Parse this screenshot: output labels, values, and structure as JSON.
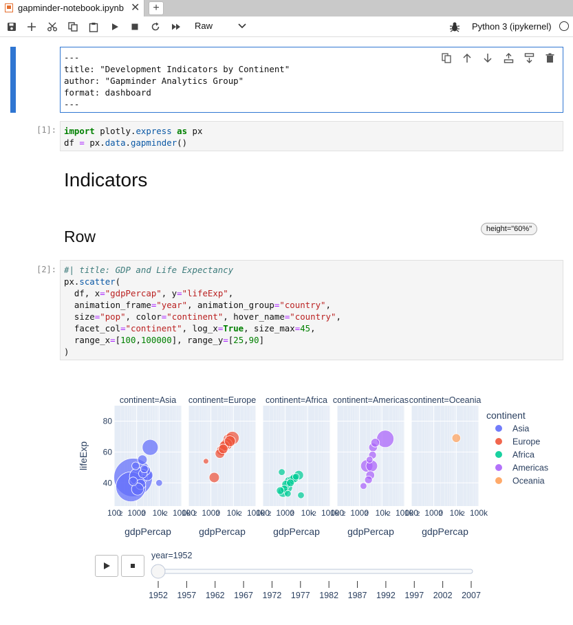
{
  "tab": {
    "title": "gapminder-notebook.ipynb",
    "close": "✕",
    "new": "+"
  },
  "toolbar": {
    "cell_type": "Raw",
    "kernel": "Python 3 (ipykernel)",
    "icons": [
      "save-icon",
      "add-icon",
      "cut-icon",
      "copy-icon",
      "paste-icon",
      "run-icon",
      "stop-icon",
      "restart-icon",
      "fast-forward-icon"
    ]
  },
  "raw_cell": {
    "lines": [
      "---",
      "title: \"Development Indicators by Continent\"",
      "author: \"Gapminder Analytics Group\"",
      "format: dashboard",
      "---"
    ]
  },
  "cell1": {
    "prompt": "[1]:"
  },
  "markdown": {
    "h1": "Indicators",
    "h2": "Row",
    "badge": "height=\"60%\""
  },
  "cell2": {
    "prompt": "[2]:"
  },
  "chart_data": {
    "type": "scatter",
    "facets": [
      "continent=Asia",
      "continent=Europe",
      "continent=Africa",
      "continent=Americas",
      "continent=Oceania"
    ],
    "xlabel": "gdpPercap",
    "ylabel": "lifeExp",
    "x_scale": "log",
    "xlim": [
      100,
      100000
    ],
    "ylim": [
      25,
      90
    ],
    "x_ticks": [
      "100",
      "2",
      "1000",
      "2",
      "10k",
      "2",
      "100k"
    ],
    "y_ticks": [
      40,
      60,
      80
    ],
    "legend_title": "continent",
    "legend_placement": "right",
    "legend": [
      {
        "name": "Asia",
        "color": "#636efa"
      },
      {
        "name": "Europe",
        "color": "#ef553b"
      },
      {
        "name": "Africa",
        "color": "#00cc96"
      },
      {
        "name": "Americas",
        "color": "#ab63fa"
      },
      {
        "name": "Oceania",
        "color": "#ffa15a"
      }
    ],
    "series": [
      {
        "name": "Asia",
        "color": "#636efa",
        "points": [
          {
            "x": 700,
            "y": 43.5,
            "s": 1.0
          },
          {
            "x": 550,
            "y": 37.5,
            "s": 0.6
          },
          {
            "x": 1200,
            "y": 44,
            "s": 0.22
          },
          {
            "x": 4000,
            "y": 63,
            "s": 0.17
          },
          {
            "x": 3000,
            "y": 45,
            "s": 0.08
          },
          {
            "x": 1800,
            "y": 55,
            "s": 0.06
          },
          {
            "x": 2500,
            "y": 48,
            "s": 0.06
          },
          {
            "x": 1500,
            "y": 39,
            "s": 0.07
          },
          {
            "x": 1100,
            "y": 36,
            "s": 0.1
          },
          {
            "x": 1900,
            "y": 46,
            "s": 0.05
          },
          {
            "x": 700,
            "y": 41,
            "s": 0.05
          },
          {
            "x": 900,
            "y": 51,
            "s": 0.04
          },
          {
            "x": 10000,
            "y": 40,
            "s": 0.03
          },
          {
            "x": 2200,
            "y": 49,
            "s": 0.04
          }
        ]
      },
      {
        "name": "Europe",
        "color": "#ef553b",
        "points": [
          {
            "x": 1400,
            "y": 43.5,
            "s": 0.07
          },
          {
            "x": 6500,
            "y": 68,
            "s": 0.1
          },
          {
            "x": 9000,
            "y": 69,
            "s": 0.12
          },
          {
            "x": 5000,
            "y": 65,
            "s": 0.09
          },
          {
            "x": 3000,
            "y": 61,
            "s": 0.07
          },
          {
            "x": 4000,
            "y": 64,
            "s": 0.07
          },
          {
            "x": 7000,
            "y": 67,
            "s": 0.08
          },
          {
            "x": 2500,
            "y": 59,
            "s": 0.06
          },
          {
            "x": 3500,
            "y": 62,
            "s": 0.06
          },
          {
            "x": 600,
            "y": 54,
            "s": 0.02
          }
        ]
      },
      {
        "name": "Africa",
        "color": "#00cc96",
        "points": [
          {
            "x": 4000,
            "y": 45,
            "s": 0.06
          },
          {
            "x": 1200,
            "y": 37,
            "s": 0.08
          },
          {
            "x": 800,
            "y": 34,
            "s": 0.07
          },
          {
            "x": 1500,
            "y": 41,
            "s": 0.06
          },
          {
            "x": 2000,
            "y": 42,
            "s": 0.05
          },
          {
            "x": 1100,
            "y": 39,
            "s": 0.05
          },
          {
            "x": 2500,
            "y": 43,
            "s": 0.05
          },
          {
            "x": 900,
            "y": 36,
            "s": 0.04
          },
          {
            "x": 600,
            "y": 35,
            "s": 0.04
          },
          {
            "x": 1700,
            "y": 40,
            "s": 0.04
          },
          {
            "x": 5000,
            "y": 32,
            "s": 0.03
          },
          {
            "x": 700,
            "y": 47,
            "s": 0.03
          },
          {
            "x": 1300,
            "y": 33,
            "s": 0.03
          },
          {
            "x": 3000,
            "y": 44,
            "s": 0.03
          }
        ]
      },
      {
        "name": "Americas",
        "color": "#ab63fa",
        "points": [
          {
            "x": 14000,
            "y": 68.5,
            "s": 0.2
          },
          {
            "x": 2100,
            "y": 51,
            "s": 0.1
          },
          {
            "x": 3500,
            "y": 51,
            "s": 0.09
          },
          {
            "x": 3000,
            "y": 45,
            "s": 0.05
          },
          {
            "x": 4000,
            "y": 63,
            "s": 0.05
          },
          {
            "x": 5000,
            "y": 66,
            "s": 0.05
          },
          {
            "x": 2500,
            "y": 42,
            "s": 0.04
          },
          {
            "x": 1500,
            "y": 38,
            "s": 0.03
          },
          {
            "x": 3800,
            "y": 58,
            "s": 0.04
          },
          {
            "x": 2800,
            "y": 55,
            "s": 0.03
          }
        ]
      },
      {
        "name": "Oceania",
        "color": "#ffa15a",
        "points": [
          {
            "x": 10000,
            "y": 69,
            "s": 0.05
          }
        ]
      }
    ],
    "slider": {
      "label": "year=1952",
      "years": [
        "1952",
        "1957",
        "1962",
        "1967",
        "1972",
        "1977",
        "1982",
        "1987",
        "1992",
        "1997",
        "2002",
        "2007"
      ],
      "current": "1952"
    }
  }
}
